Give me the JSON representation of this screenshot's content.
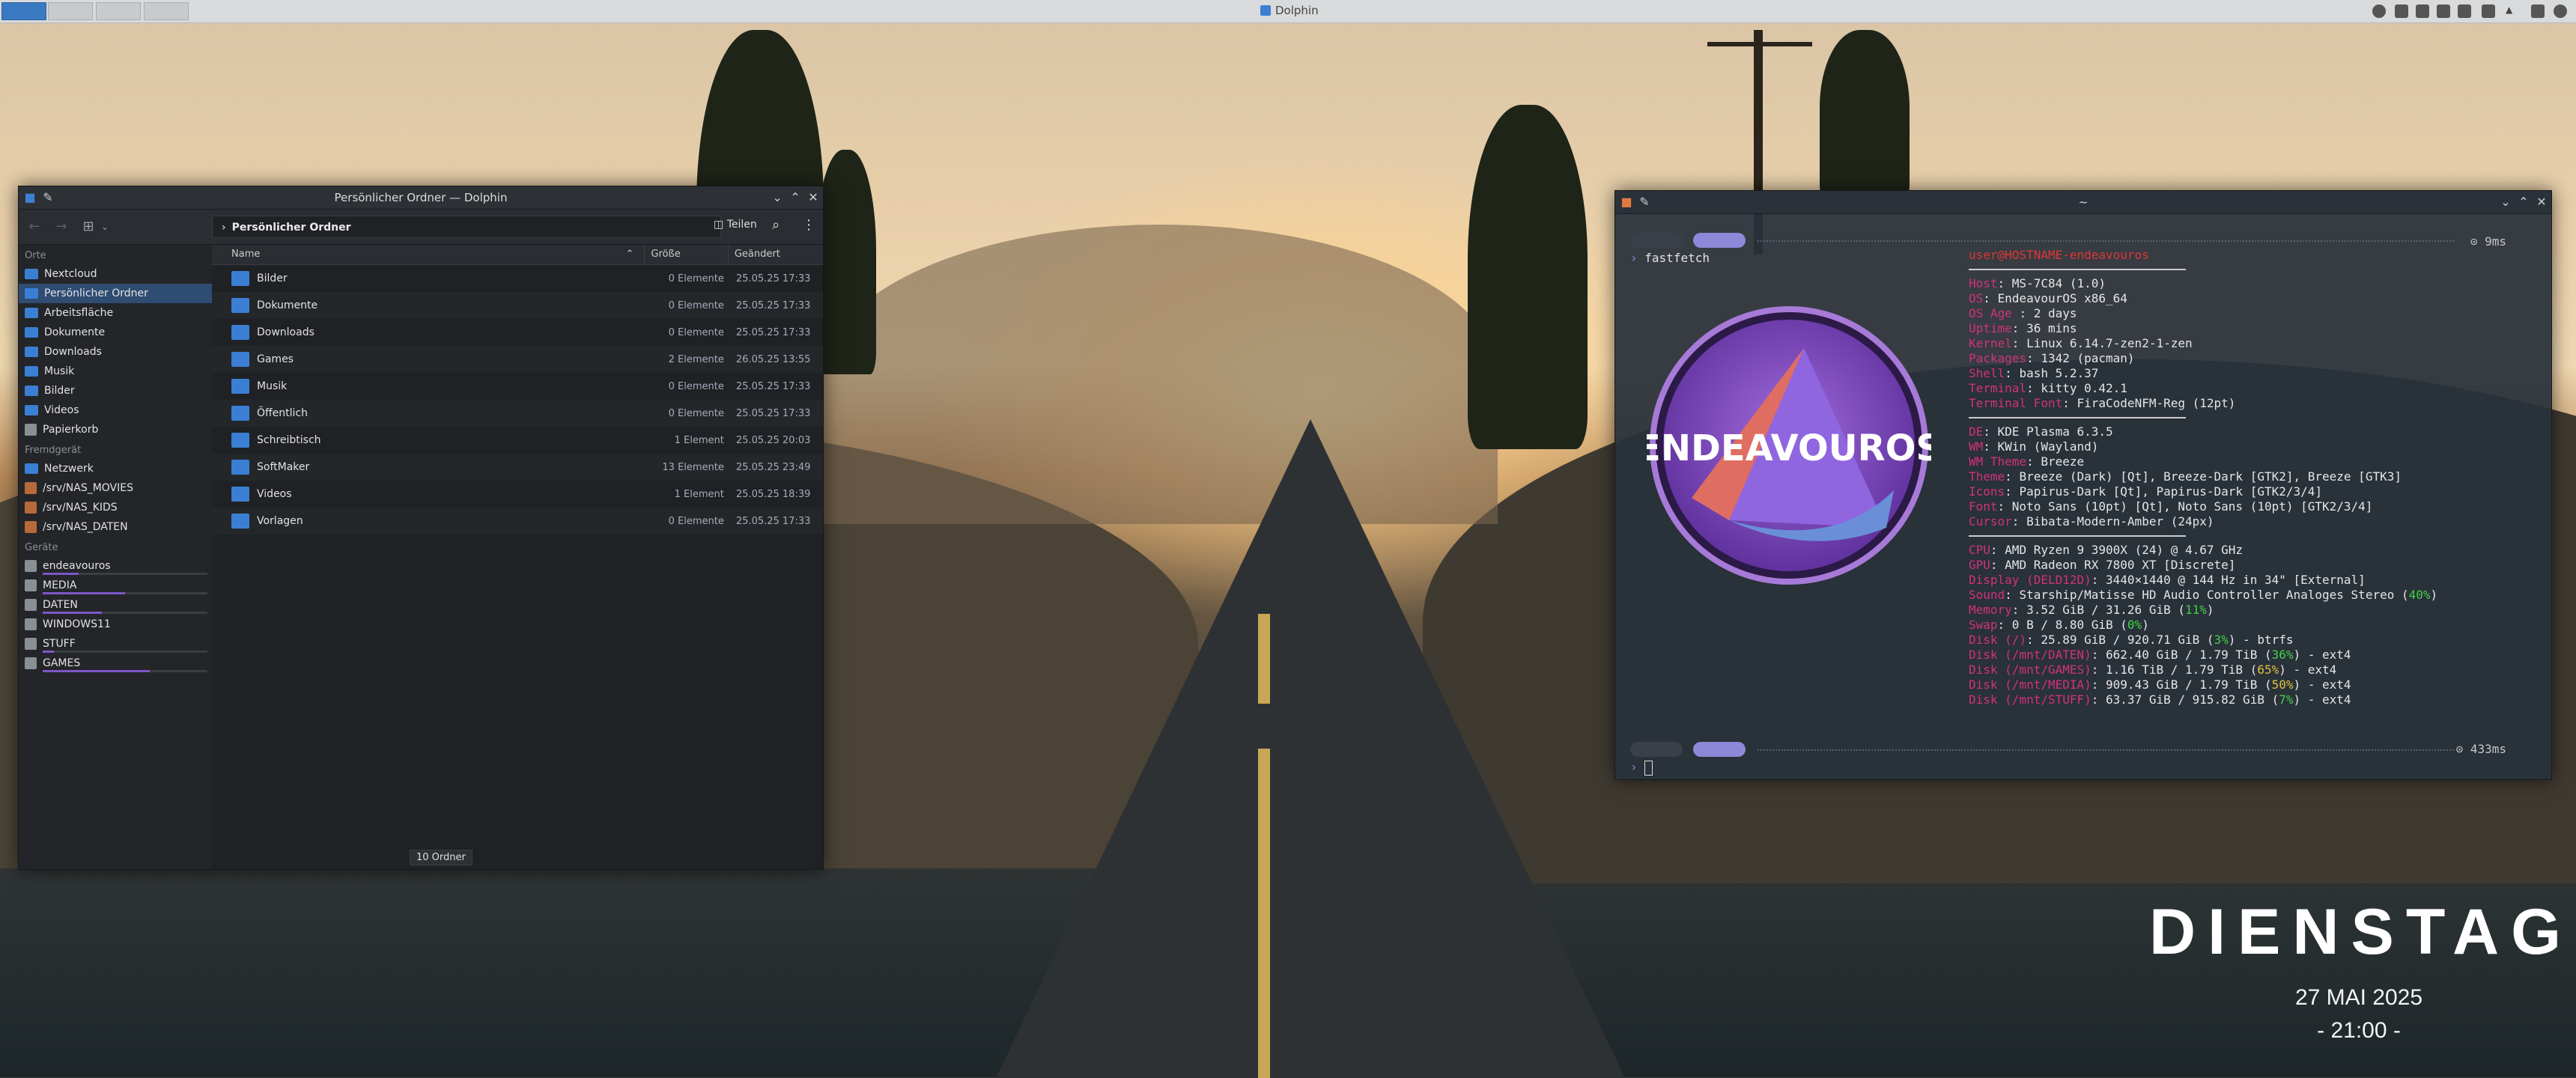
{
  "top_panel": {
    "active_window_title": "Dolphin"
  },
  "dolphin": {
    "window_title": "Persönlicher Ordner — Dolphin",
    "breadcrumb": "Persönlicher Ordner",
    "split_label": "Teilen",
    "places": {
      "section_places": "Orte",
      "items": [
        "Nextcloud",
        "Persönlicher Ordner",
        "Arbeitsfläche",
        "Dokumente",
        "Downloads",
        "Musik",
        "Bilder",
        "Videos",
        "Papierkorb"
      ],
      "section_remote": "Fremdgerät",
      "remote": [
        "Netzwerk",
        "/srv/NAS_MOVIES",
        "/srv/NAS_KIDS",
        "/srv/NAS_DATEN"
      ],
      "section_devices": "Geräte",
      "devices": [
        "endeavouros",
        "MEDIA",
        "DATEN",
        "WINDOWS11",
        "STUFF",
        "GAMES"
      ],
      "device_usage": [
        0.22,
        0.5,
        0.36,
        0.0,
        0.07,
        0.65
      ]
    },
    "columns": {
      "name": "Name",
      "size": "Größe",
      "modified": "Geändert"
    },
    "files": [
      {
        "name": "Bilder",
        "size": "0 Elemente",
        "date": "25.05.25 17:33"
      },
      {
        "name": "Dokumente",
        "size": "0 Elemente",
        "date": "25.05.25 17:33"
      },
      {
        "name": "Downloads",
        "size": "0 Elemente",
        "date": "25.05.25 17:33"
      },
      {
        "name": "Games",
        "size": "2 Elemente",
        "date": "26.05.25 13:55"
      },
      {
        "name": "Musik",
        "size": "0 Elemente",
        "date": "25.05.25 17:33"
      },
      {
        "name": "Öffentlich",
        "size": "0 Elemente",
        "date": "25.05.25 17:33"
      },
      {
        "name": "Schreibtisch",
        "size": "1 Element",
        "date": "25.05.25 20:03"
      },
      {
        "name": "SoftMaker",
        "size": "13 Elemente",
        "date": "25.05.25 23:49"
      },
      {
        "name": "Videos",
        "size": "1 Element",
        "date": "25.05.25 18:39"
      },
      {
        "name": "Vorlagen",
        "size": "0 Elemente",
        "date": "25.05.25 17:33"
      }
    ],
    "status": "10 Ordner"
  },
  "terminal": {
    "window_title": "~",
    "command": "fastfetch",
    "timing_top": "⊙ 9ms",
    "timing_bottom": "⊙ 433ms",
    "logo_text": "ENDEAVOUROS",
    "header": "user@HOSTNAME-endeavouros",
    "group1": [
      {
        "k": "Host",
        "v": ": MS-7C84 (1.0)"
      },
      {
        "k": "OS",
        "v": ": EndeavourOS x86_64"
      },
      {
        "k": "OS Age ",
        "v": ": 2 days"
      },
      {
        "k": "Uptime",
        "v": ": 36 mins"
      },
      {
        "k": "Kernel",
        "v": ": Linux 6.14.7-zen2-1-zen"
      },
      {
        "k": "Packages",
        "v": ": 1342 (pacman)"
      },
      {
        "k": "Shell",
        "v": ": bash 5.2.37"
      },
      {
        "k": "Terminal",
        "v": ": kitty 0.42.1"
      },
      {
        "k": "Terminal Font",
        "v": ": FiraCodeNFM-Reg (12pt)"
      }
    ],
    "group2": [
      {
        "k": "DE",
        "v": ": KDE Plasma 6.3.5"
      },
      {
        "k": "WM",
        "v": ": KWin (Wayland)"
      },
      {
        "k": "WM Theme",
        "v": ": Breeze"
      },
      {
        "k": "Theme",
        "v": ": Breeze (Dark) [Qt], Breeze-Dark [GTK2], Breeze [GTK3]"
      },
      {
        "k": "Icons",
        "v": ": Papirus-Dark [Qt], Papirus-Dark [GTK2/3/4]"
      },
      {
        "k": "Font",
        "v": ": Noto Sans (10pt) [Qt], Noto Sans (10pt) [GTK2/3/4]"
      },
      {
        "k": "Cursor",
        "v": ": Bibata-Modern-Amber (24px)"
      }
    ],
    "group3": [
      {
        "k": "CPU",
        "v": ": AMD Ryzen 9 3900X (24) @ 4.67 GHz",
        "p": "",
        "rest": ""
      },
      {
        "k": "GPU",
        "v": ": AMD Radeon RX 7800 XT [Discrete]",
        "p": "",
        "rest": ""
      },
      {
        "k": "Display (DELD12D)",
        "v": ": 3440×1440 @ 144 Hz in 34\" [External]",
        "p": "",
        "rest": ""
      },
      {
        "k": "Sound",
        "v": ": Starship/Matisse HD Audio Controller Analoges Stereo (",
        "p": "40%",
        "rest": ")"
      },
      {
        "k": "Memory",
        "v": ": 3.52 GiB / 31.26 GiB (",
        "p": "11%",
        "rest": ")"
      },
      {
        "k": "Swap",
        "v": ": 0 B / 8.80 GiB (",
        "p": "0%",
        "rest": ")"
      },
      {
        "k": "Disk (/)",
        "v": ": 25.89 GiB / 920.71 GiB (",
        "p": "3%",
        "rest": ") - btrfs"
      },
      {
        "k": "Disk (/mnt/DATEN)",
        "v": ": 662.40 GiB / 1.79 TiB (",
        "p": "36%",
        "rest": ") - ext4"
      },
      {
        "k": "Disk (/mnt/GAMES)",
        "v": ": 1.16 TiB / 1.79 TiB (",
        "p": "65%",
        "rest": ") - ext4"
      },
      {
        "k": "Disk (/mnt/MEDIA)",
        "v": ": 909.43 GiB / 1.79 TiB (",
        "p": "50%",
        "rest": ") - ext4"
      },
      {
        "k": "Disk (/mnt/STUFF)",
        "v": ": 63.37 GiB / 915.82 GiB (",
        "p": "7%",
        "rest": ") - ext4"
      }
    ]
  },
  "clock": {
    "day": "DIENSTAG",
    "date": "27 MAI 2025",
    "time": "- 21:00 -"
  }
}
